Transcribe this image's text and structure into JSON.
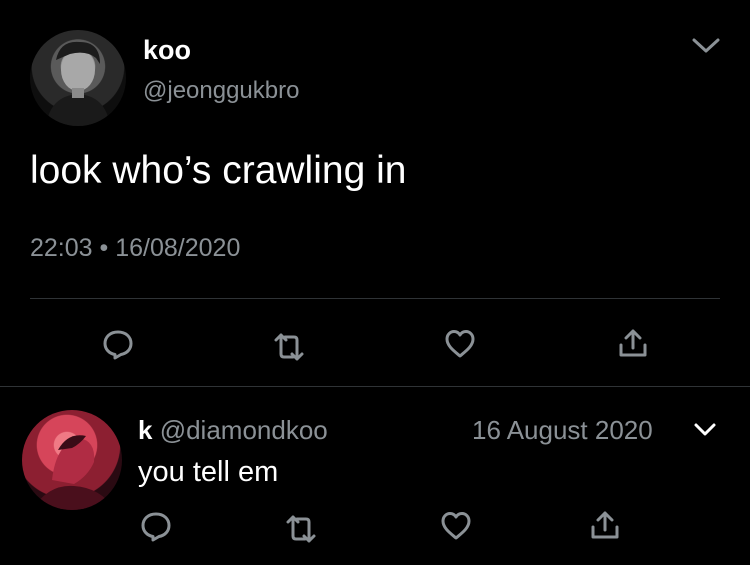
{
  "tweet": {
    "display_name": "koo",
    "handle": "@jeonggukbro",
    "text": "look who’s crawling in",
    "time": "22:03",
    "separator": "•",
    "date": "16/08/2020"
  },
  "reply": {
    "display_name": "k",
    "handle": "@diamondkoo",
    "date": "16 August 2020",
    "text": "you tell em"
  },
  "icons": {
    "reply": "reply-icon",
    "retweet": "retweet-icon",
    "like": "heart-icon",
    "share": "share-icon",
    "more": "chevron-down-icon"
  },
  "colors": {
    "background": "#000000",
    "text": "#ffffff",
    "secondary": "#8b9196",
    "divider": "#2f3336"
  }
}
